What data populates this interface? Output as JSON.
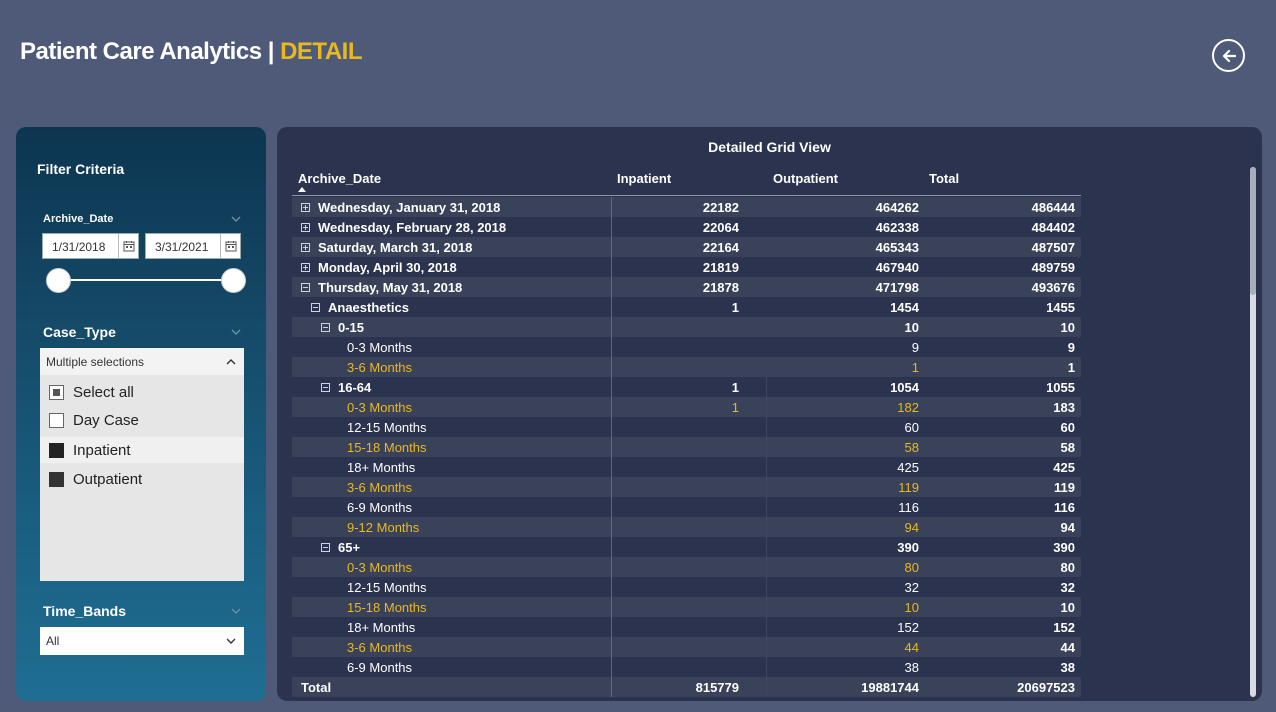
{
  "header": {
    "title": "Patient Care Analytics | ",
    "title_accent": "DETAIL",
    "back_icon": "back-arrow-circle-icon",
    "accent_color": "#e8b820"
  },
  "filters": {
    "title": "Filter Criteria",
    "archive_date": {
      "label": "Archive_Date",
      "start": "1/31/2018",
      "end": "3/31/2021"
    },
    "case_type": {
      "label": "Case_Type",
      "selected_text": "Multiple selections",
      "options": [
        {
          "label": "Select all",
          "state": "partial"
        },
        {
          "label": "Day Case",
          "state": "unchecked"
        },
        {
          "label": "Inpatient",
          "state": "checked"
        },
        {
          "label": "Outpatient",
          "state": "checked"
        }
      ]
    },
    "time_bands": {
      "label": "Time_Bands",
      "selected": "All"
    }
  },
  "grid": {
    "title": "Detailed Grid View",
    "columns": [
      "Archive_Date",
      "Inpatient",
      "Outpatient",
      "Total"
    ],
    "rows": [
      {
        "level": 0,
        "expander": "plus",
        "label": "Wednesday, January 31, 2018",
        "inpatient": "22182",
        "outpatient": "464262",
        "total": "486444",
        "bold": true
      },
      {
        "level": 0,
        "expander": "plus",
        "label": "Wednesday, February 28, 2018",
        "inpatient": "22064",
        "outpatient": "462338",
        "total": "484402",
        "bold": true
      },
      {
        "level": 0,
        "expander": "plus",
        "label": "Saturday, March 31, 2018",
        "inpatient": "22164",
        "outpatient": "465343",
        "total": "487507",
        "bold": true
      },
      {
        "level": 0,
        "expander": "plus",
        "label": "Monday, April 30, 2018",
        "inpatient": "21819",
        "outpatient": "467940",
        "total": "489759",
        "bold": true
      },
      {
        "level": 0,
        "expander": "minus",
        "label": "Thursday, May 31, 2018",
        "inpatient": "21878",
        "outpatient": "471798",
        "total": "493676",
        "bold": true
      },
      {
        "level": 1,
        "expander": "minus",
        "label": "Anaesthetics",
        "inpatient": "1",
        "outpatient": "1454",
        "total": "1455",
        "bold": true
      },
      {
        "level": 2,
        "expander": "minus",
        "label": "0-15",
        "inpatient": "",
        "outpatient": "10",
        "total": "10",
        "bold": true
      },
      {
        "level": 3,
        "expander": "",
        "label": "0-3 Months",
        "inpatient": "",
        "outpatient": "9",
        "total": "9"
      },
      {
        "level": 3,
        "expander": "",
        "label": "3-6 Months",
        "inpatient": "",
        "outpatient": "1",
        "total": "1",
        "yellow": true
      },
      {
        "level": 2,
        "expander": "minus",
        "label": "16-64",
        "inpatient": "1",
        "outpatient": "1054",
        "total": "1055",
        "bold": true
      },
      {
        "level": 3,
        "expander": "",
        "label": "0-3 Months",
        "inpatient": "1",
        "outpatient": "182",
        "total": "183",
        "yellow": true
      },
      {
        "level": 3,
        "expander": "",
        "label": "12-15 Months",
        "inpatient": "",
        "outpatient": "60",
        "total": "60"
      },
      {
        "level": 3,
        "expander": "",
        "label": "15-18 Months",
        "inpatient": "",
        "outpatient": "58",
        "total": "58",
        "yellow": true
      },
      {
        "level": 3,
        "expander": "",
        "label": "18+ Months",
        "inpatient": "",
        "outpatient": "425",
        "total": "425"
      },
      {
        "level": 3,
        "expander": "",
        "label": "3-6 Months",
        "inpatient": "",
        "outpatient": "119",
        "total": "119",
        "yellow": true
      },
      {
        "level": 3,
        "expander": "",
        "label": "6-9 Months",
        "inpatient": "",
        "outpatient": "116",
        "total": "116"
      },
      {
        "level": 3,
        "expander": "",
        "label": "9-12 Months",
        "inpatient": "",
        "outpatient": "94",
        "total": "94",
        "yellow": true
      },
      {
        "level": 2,
        "expander": "minus",
        "label": "65+",
        "inpatient": "",
        "outpatient": "390",
        "total": "390",
        "bold": true
      },
      {
        "level": 3,
        "expander": "",
        "label": "0-3 Months",
        "inpatient": "",
        "outpatient": "80",
        "total": "80",
        "yellow": true
      },
      {
        "level": 3,
        "expander": "",
        "label": "12-15 Months",
        "inpatient": "",
        "outpatient": "32",
        "total": "32"
      },
      {
        "level": 3,
        "expander": "",
        "label": "15-18 Months",
        "inpatient": "",
        "outpatient": "10",
        "total": "10",
        "yellow": true
      },
      {
        "level": 3,
        "expander": "",
        "label": "18+ Months",
        "inpatient": "",
        "outpatient": "152",
        "total": "152"
      },
      {
        "level": 3,
        "expander": "",
        "label": "3-6 Months",
        "inpatient": "",
        "outpatient": "44",
        "total": "44",
        "yellow": true
      },
      {
        "level": 3,
        "expander": "",
        "label": "6-9 Months",
        "inpatient": "",
        "outpatient": "38",
        "total": "38"
      }
    ],
    "total_row": {
      "label": "Total",
      "inpatient": "815779",
      "outpatient": "19881744",
      "total": "20697523"
    }
  }
}
